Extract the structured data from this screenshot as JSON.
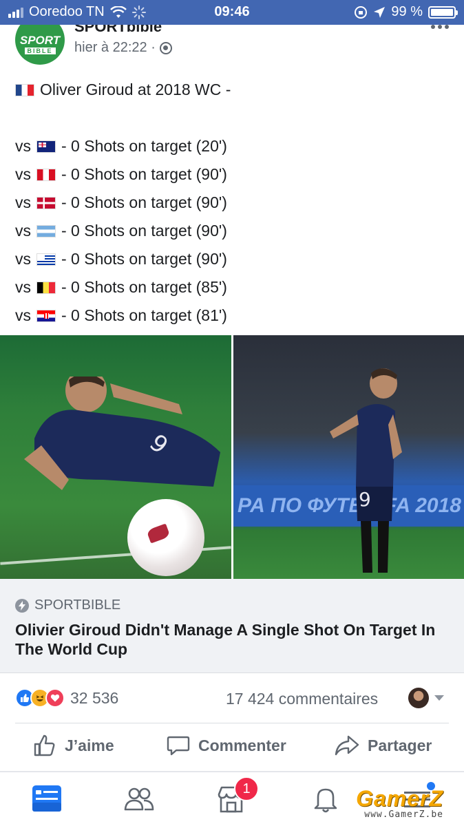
{
  "status_bar": {
    "carrier": "Ooredoo TN",
    "time": "09:46",
    "battery": "99 %",
    "battery_level": 0.99
  },
  "post": {
    "page_name": "SPORTbible",
    "timestamp": "hier à 22:22 ·",
    "avatar": {
      "top": "SPORT",
      "bottom": "BIBLE"
    },
    "headline": "Oliver Giroud at 2018 WC -",
    "headline_flag": "france-flag",
    "lines": [
      {
        "prefix": "vs",
        "flag": "australia-flag",
        "text": "- 0 Shots on target (20')"
      },
      {
        "prefix": "vs",
        "flag": "peru-flag",
        "text": "- 0 Shots on target (90')"
      },
      {
        "prefix": "vs",
        "flag": "denmark-flag",
        "text": "- 0 Shots on target (90')"
      },
      {
        "prefix": "vs",
        "flag": "argentina-flag",
        "text": "- 0 Shots on target (90')"
      },
      {
        "prefix": "vs",
        "flag": "uruguay-flag",
        "text": "- 0 Shots on target (90')"
      },
      {
        "prefix": "vs",
        "flag": "belgium-flag",
        "text": "- 0 Shots on target (85')"
      },
      {
        "prefix": "vs",
        "flag": "croatia-flag",
        "text": "- 0 Shots on target (81')"
      }
    ]
  },
  "photos": {
    "left_jersey_number": "9",
    "right_jersey_number": "9",
    "board_text": "РА ПО ФУТБ     ИFA 2018"
  },
  "link_preview": {
    "source": "SPORTBIBLE",
    "title": "Olivier Giroud Didn't Manage A Single Shot On Target In The World Cup"
  },
  "engagement": {
    "reaction_icons": [
      "like-icon",
      "haha-icon",
      "love-icon"
    ],
    "reaction_count": "32 536",
    "comment_count": "17 424 commentaires"
  },
  "actions": {
    "like": "J’aime",
    "comment": "Commenter",
    "share": "Partager"
  },
  "tab_bar": {
    "items": [
      "news-feed-icon",
      "friends-icon",
      "marketplace-icon",
      "notifications-icon",
      "menu-icon"
    ],
    "marketplace_badge": "1"
  },
  "watermark": {
    "brand": "GamerZ",
    "url": "www.GamerZ.be"
  },
  "colors": {
    "status_bar": "#4267b2",
    "fb_blue": "#2078f4",
    "badge_red": "#f02849",
    "secondary_text": "#606770"
  }
}
